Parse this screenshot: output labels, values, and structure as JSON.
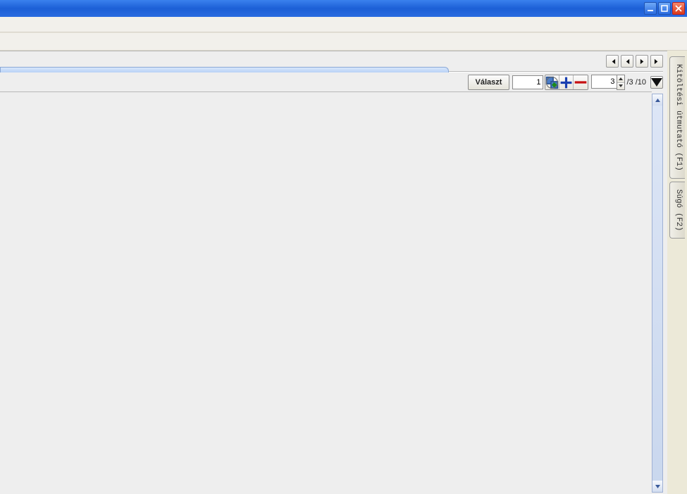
{
  "window": {
    "minimize_title": "Minimize",
    "maximize_title": "Maximize",
    "close_title": "Close"
  },
  "nav": {
    "first_title": "First",
    "prev_title": "Previous",
    "next_title": "Next",
    "last_title": "Last"
  },
  "controls": {
    "select_label": "Választ",
    "input1_value": "1",
    "duplicate_title": "Duplicate",
    "add_title": "Add",
    "remove_title": "Remove",
    "spinner_value": "3",
    "page_text": "/3 /10",
    "dropdown_title": "Menu"
  },
  "sidetabs": {
    "guide_label": "Kitöltési útmutató (F1)",
    "help_label": "Súgó (F2)"
  }
}
